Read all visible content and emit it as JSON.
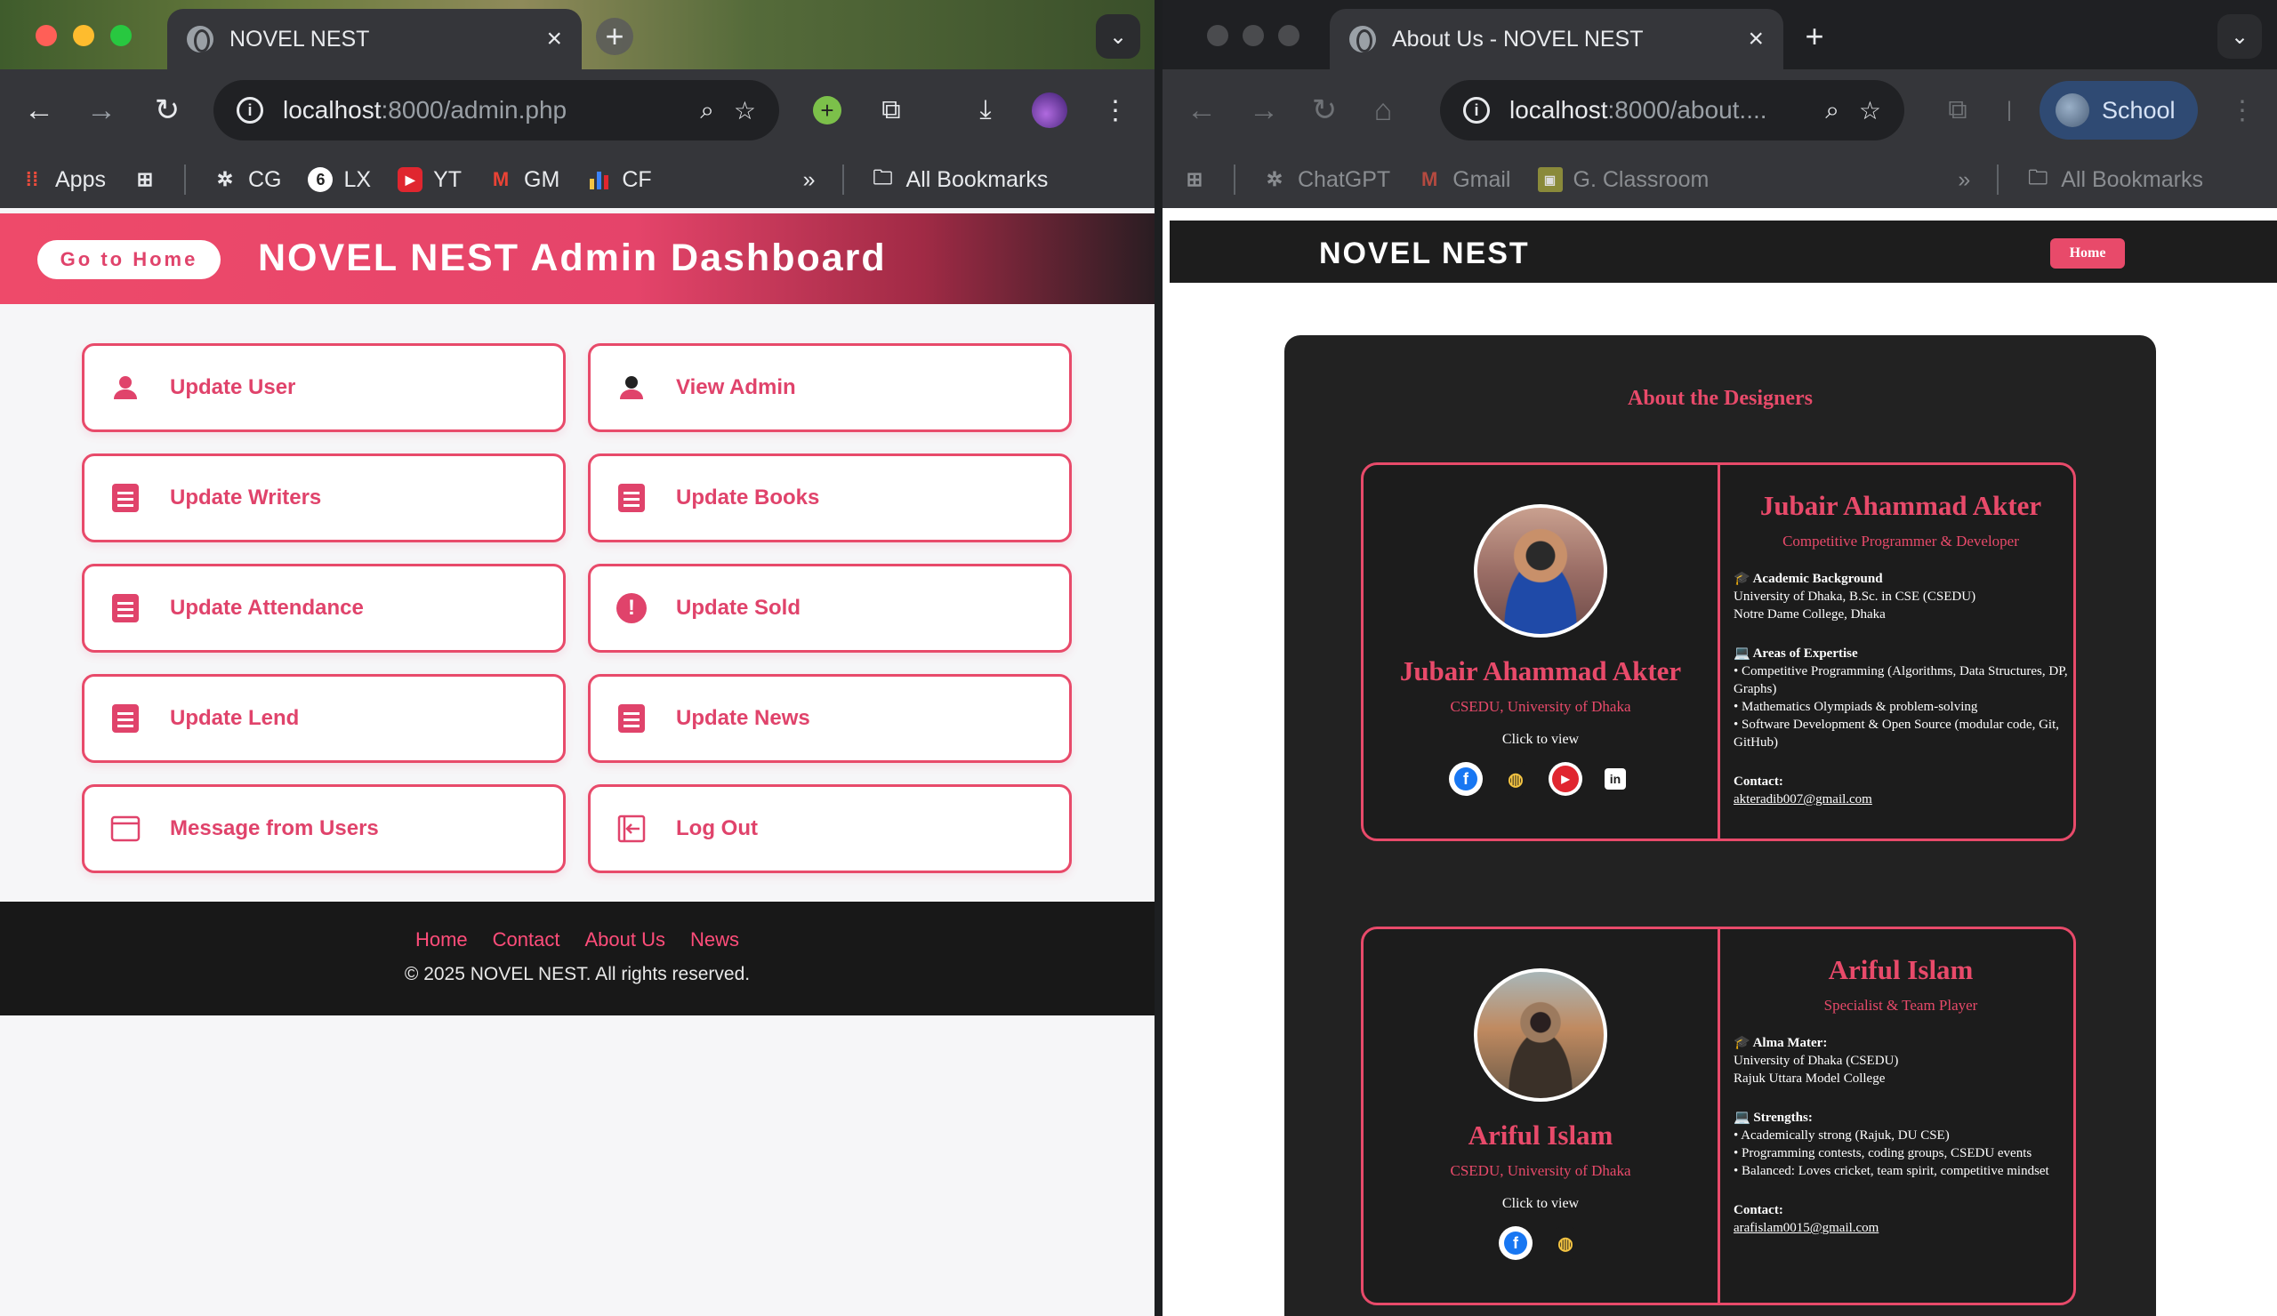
{
  "left_window": {
    "tab_title": "NOVEL NEST",
    "url_host": "localhost",
    "url_rest": ":8000/admin.php",
    "bookmarks": [
      {
        "label": "Apps",
        "icon": "apps-grid-icon"
      },
      {
        "label": "CG",
        "icon": "chatgpt-icon"
      },
      {
        "label": "LX",
        "icon": "lx-icon"
      },
      {
        "label": "YT",
        "icon": "youtube-icon"
      },
      {
        "label": "GM",
        "icon": "gmail-icon"
      },
      {
        "label": "CF",
        "icon": "chart-icon"
      }
    ],
    "all_bookmarks": "All Bookmarks",
    "more_glyph": "»"
  },
  "admin": {
    "home_button": "Go to Home",
    "title": "NOVEL NEST Admin Dashboard",
    "cards": [
      {
        "label": "Update User",
        "icon": "user-icon"
      },
      {
        "label": "View Admin",
        "icon": "admin-icon"
      },
      {
        "label": "Update Writers",
        "icon": "document-icon"
      },
      {
        "label": "Update Books",
        "icon": "document-icon"
      },
      {
        "label": "Update Attendance",
        "icon": "document-icon"
      },
      {
        "label": "Update Sold",
        "icon": "alert-icon"
      },
      {
        "label": "Update Lend",
        "icon": "document-icon"
      },
      {
        "label": "Update News",
        "icon": "document-icon"
      },
      {
        "label": "Message from Users",
        "icon": "window-icon"
      },
      {
        "label": "Log Out",
        "icon": "logout-icon"
      }
    ],
    "footer_links": [
      "Home",
      "Contact",
      "About Us",
      "News"
    ],
    "copyright": "© 2025 NOVEL NEST. All rights reserved."
  },
  "right_window": {
    "tab_title": "About Us - NOVEL NEST",
    "url_host": "localhost",
    "url_rest": ":8000/about....",
    "profile_label": "School",
    "bookmarks": [
      {
        "label": "ChatGPT",
        "icon": "chatgpt-icon"
      },
      {
        "label": "Gmail",
        "icon": "gmail-icon"
      },
      {
        "label": "G. Classroom",
        "icon": "classroom-icon"
      }
    ],
    "all_bookmarks": "All Bookmarks",
    "more_glyph": "»"
  },
  "about": {
    "brand": "NOVEL NEST",
    "home_button": "Home",
    "heading": "About the Designers",
    "people": [
      {
        "name": "Jubair Ahammad Akter",
        "affiliation": "CSEDU, University of Dhaka",
        "click_text": "Click to view",
        "tagline": "Competitive Programmer & Developer",
        "section1_title": "🎓 Academic Background",
        "section1_lines": [
          "University of Dhaka, B.Sc. in CSE (CSEDU)",
          "Notre Dame College, Dhaka"
        ],
        "section2_title": "💻 Areas of Expertise",
        "section2_lines": [
          "• Competitive Programming (Algorithms, Data Structures, DP, Graphs)",
          "• Mathematics Olympiads & problem-solving",
          "• Software Development & Open Source (modular code, Git, GitHub)"
        ],
        "contact_label": "Contact:",
        "email": "akteradib007@gmail.com"
      },
      {
        "name": "Ariful Islam",
        "affiliation": "CSEDU, University of Dhaka",
        "click_text": "Click to view",
        "tagline": "Specialist & Team Player",
        "section1_title": "🎓 Alma Mater:",
        "section1_lines": [
          "University of Dhaka (CSEDU)",
          "Rajuk Uttara Model College"
        ],
        "section2_title": "💻 Strengths:",
        "section2_lines": [
          "• Academically strong (Rajuk, DU CSE)",
          "• Programming contests, coding groups, CSEDU events",
          "• Balanced: Loves cricket, team spirit, competitive mindset"
        ],
        "contact_label": "Contact:",
        "email": "arafislam0015@gmail.com"
      }
    ]
  },
  "colors": {
    "accent": "#e84a6a",
    "dark_panel": "#222222",
    "chrome_dark": "#35363a"
  }
}
